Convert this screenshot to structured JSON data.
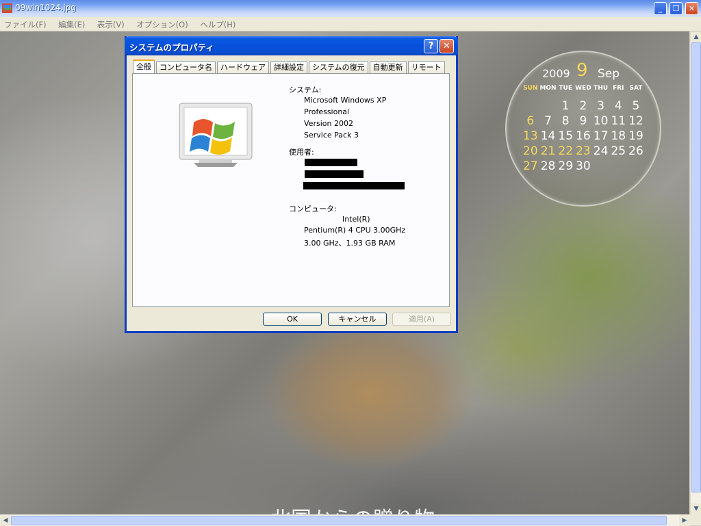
{
  "window": {
    "title": "09win1024.jpg",
    "menu": [
      "ファイル(F)",
      "編集(E)",
      "表示(V)",
      "オプション(O)",
      "ヘルプ(H)"
    ]
  },
  "photo": {
    "caption": "北国からの贈り物"
  },
  "calendar": {
    "year": "2009",
    "day": "9",
    "month": "Sep",
    "weekdays": [
      "SUN",
      "MON",
      "TUE",
      "WED",
      "THU",
      "FRI",
      "SAT"
    ],
    "days": [
      "",
      "",
      "1",
      "2",
      "3",
      "4",
      "5",
      "6",
      "7",
      "8",
      "9",
      "10",
      "11",
      "12",
      "13",
      "14",
      "15",
      "16",
      "17",
      "18",
      "19",
      "20",
      "21",
      "22",
      "23",
      "24",
      "25",
      "26",
      "27",
      "28",
      "29",
      "30"
    ],
    "highlighted_days": [
      "6",
      "13",
      "20",
      "21",
      "22",
      "23",
      "27"
    ]
  },
  "dialog": {
    "title": "システムのプロパティ",
    "tabs": [
      "全般",
      "コンピュータ名",
      "ハードウェア",
      "詳細設定",
      "システムの復元",
      "自動更新",
      "リモート"
    ],
    "active_tab": "全般",
    "system_label": "システム:",
    "system_lines": [
      "Microsoft Windows XP",
      "Professional",
      "Version 2002",
      "Service Pack 3"
    ],
    "user_label": "使用者:",
    "computer_label": "コンピュータ:",
    "computer_lines": [
      "Intel(R)",
      "Pentium(R) 4 CPU 3.00GHz",
      "3.00 GHz、1.93 GB RAM"
    ],
    "buttons": {
      "ok": "OK",
      "cancel": "キャンセル",
      "apply": "適用(A)"
    }
  },
  "colors": {
    "titlebar_blue": "#0651db",
    "calendar_accent": "#f6d85a",
    "tab_active_border": "#f5a623"
  }
}
